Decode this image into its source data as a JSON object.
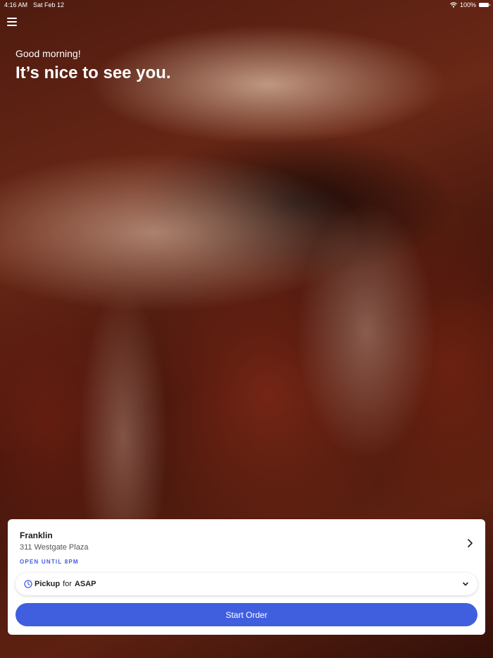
{
  "status_bar": {
    "time": "4:16 AM",
    "date": "Sat Feb 12",
    "battery": "100%"
  },
  "header": {
    "greeting": "Good morning!",
    "headline": "It’s nice to see you."
  },
  "store": {
    "name": "Franklin",
    "address": "311 Westgate Plaza",
    "open_status": "OPEN UNTIL 8PM"
  },
  "order": {
    "mode": "Pickup",
    "for_label": "for",
    "time": "ASAP",
    "start_label": "Start Order"
  },
  "colors": {
    "accent": "#3f5fdf",
    "card_bg": "#ffffff"
  },
  "icons": [
    "menu-icon",
    "wifi-icon",
    "battery-icon",
    "chevron-right-icon",
    "clock-icon",
    "chevron-down-icon"
  ]
}
